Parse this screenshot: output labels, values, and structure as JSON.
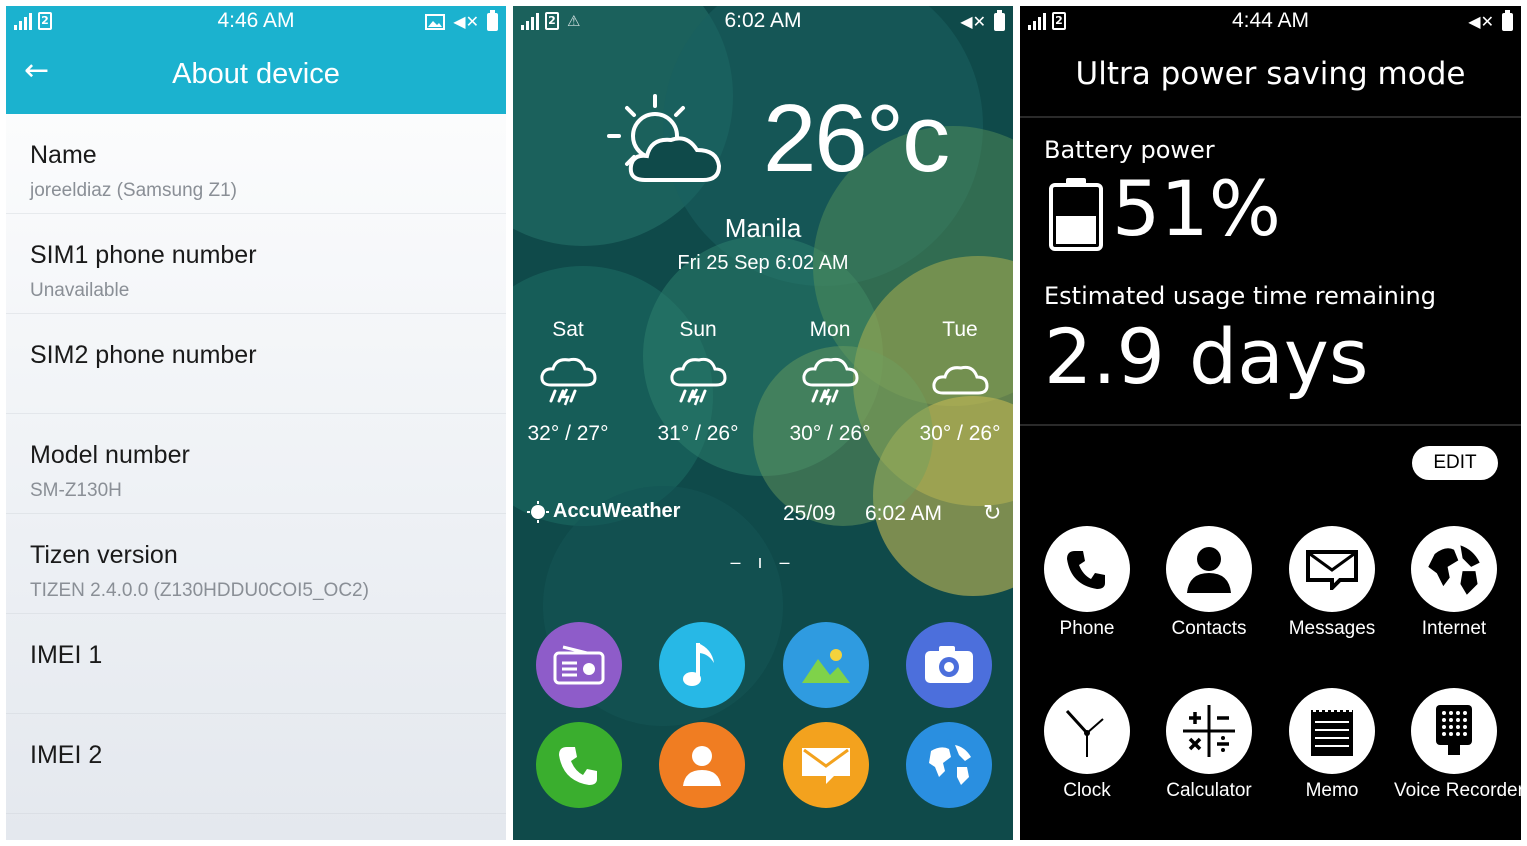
{
  "screen1": {
    "time": "4:46 AM",
    "header_title": "About device",
    "rows": [
      {
        "label": "Name",
        "value": "joreeldiaz (Samsung Z1)"
      },
      {
        "label": "SIM1 phone number",
        "value": "Unavailable"
      },
      {
        "label": "SIM2 phone number",
        "value": ""
      },
      {
        "label": "Model number",
        "value": "SM-Z130H"
      },
      {
        "label": "Tizen version",
        "value": "TIZEN 2.4.0.0 (Z130HDDU0COI5_OC2)"
      },
      {
        "label": "IMEI 1",
        "value": ""
      },
      {
        "label": "IMEI 2",
        "value": ""
      }
    ],
    "sim_badge": "2",
    "colors": {
      "header": "#1bb2cf"
    }
  },
  "screen2": {
    "time": "6:02 AM",
    "sim_badge": "2",
    "temperature": "26°c",
    "city": "Manila",
    "datetime": "Fri 25 Sep 6:02 AM",
    "forecast": [
      {
        "day": "Sat",
        "range": "32° / 27°",
        "icon": "thunder-rain-icon"
      },
      {
        "day": "Sun",
        "range": "31° / 26°",
        "icon": "thunder-rain-icon"
      },
      {
        "day": "Mon",
        "range": "30° / 26°",
        "icon": "thunder-rain-icon"
      },
      {
        "day": "Tue",
        "range": "30° / 26°",
        "icon": "cloud-icon"
      }
    ],
    "provider": "AccuWeather",
    "updated_date": "25/09",
    "updated_time": "6:02 AM",
    "pager": "– ı –",
    "apps": [
      {
        "name": "radio-icon",
        "color": "#8e5cc9"
      },
      {
        "name": "music-icon",
        "color": "#27b8e6"
      },
      {
        "name": "gallery-icon",
        "color": "#2f9be0"
      },
      {
        "name": "camera-icon",
        "color": "#4c6fdc"
      },
      {
        "name": "phone-icon",
        "color": "#3aae2e"
      },
      {
        "name": "contacts-icon",
        "color": "#f07d22"
      },
      {
        "name": "messages-icon",
        "color": "#f3a21e"
      },
      {
        "name": "internet-icon",
        "color": "#2a8fe0"
      }
    ]
  },
  "screen3": {
    "time": "4:44 AM",
    "sim_badge": "2",
    "title": "Ultra power saving mode",
    "battery_label": "Battery power",
    "battery_value": "51%",
    "usage_label": "Estimated usage time remaining",
    "usage_value": "2.9 days",
    "edit_label": "EDIT",
    "apps": [
      {
        "label": "Phone",
        "icon": "phone-icon"
      },
      {
        "label": "Contacts",
        "icon": "contacts-icon"
      },
      {
        "label": "Messages",
        "icon": "messages-icon"
      },
      {
        "label": "Internet",
        "icon": "globe-icon"
      },
      {
        "label": "Clock",
        "icon": "clock-icon"
      },
      {
        "label": "Calculator",
        "icon": "calculator-icon"
      },
      {
        "label": "Memo",
        "icon": "memo-icon"
      },
      {
        "label": "Voice Recorder",
        "icon": "voice-recorder-icon"
      }
    ]
  }
}
